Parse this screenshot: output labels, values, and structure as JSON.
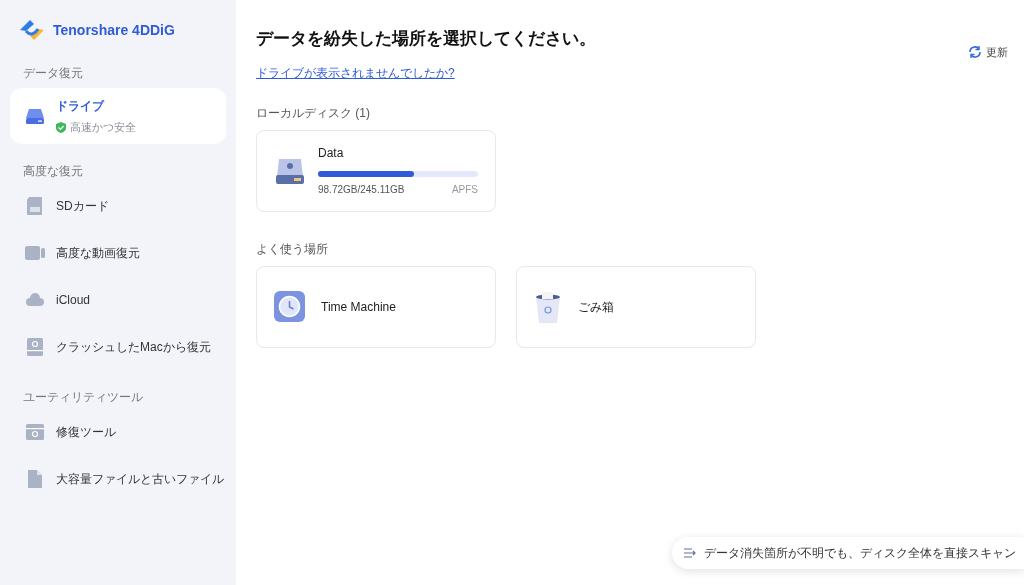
{
  "app": {
    "name": "Tenorshare 4DDiG"
  },
  "sidebar": {
    "sections": [
      {
        "title": "データ復元",
        "items": [
          {
            "kind": "drive",
            "label": "ドライブ",
            "subtitle": "高速かつ安全",
            "selected": true
          }
        ]
      },
      {
        "title": "高度な復元",
        "items": [
          {
            "kind": "sd",
            "label": "SDカード",
            "selected": false
          },
          {
            "kind": "video",
            "label": "高度な動画復元",
            "selected": false
          },
          {
            "kind": "cloud",
            "label": "iCloud",
            "selected": false
          },
          {
            "kind": "mac",
            "label": "クラッシュしたMacから復元",
            "selected": false
          }
        ]
      },
      {
        "title": "ユーティリティツール",
        "items": [
          {
            "kind": "repair",
            "label": "修復ツール",
            "selected": false
          },
          {
            "kind": "file",
            "label": "大容量ファイルと古いファイル",
            "selected": false
          }
        ]
      }
    ]
  },
  "main": {
    "title": "データを紛失した場所を選択してください。",
    "link": "ドライブが表示されませんでしたか?",
    "refresh": "更新",
    "local_disks": {
      "title": "ローカルディスク (1)",
      "items": [
        {
          "name": "Data",
          "usage": "98.72GB/245.11GB",
          "format": "APFS",
          "level": 0.6
        }
      ]
    },
    "common": {
      "title": "よく使う場所",
      "items": [
        {
          "kind": "timemachine",
          "label": "Time Machine"
        },
        {
          "kind": "trash",
          "label": "ごみ箱"
        }
      ]
    },
    "scan_bar": "データ消失箇所が不明でも、ディスク全体を直接スキャン"
  }
}
